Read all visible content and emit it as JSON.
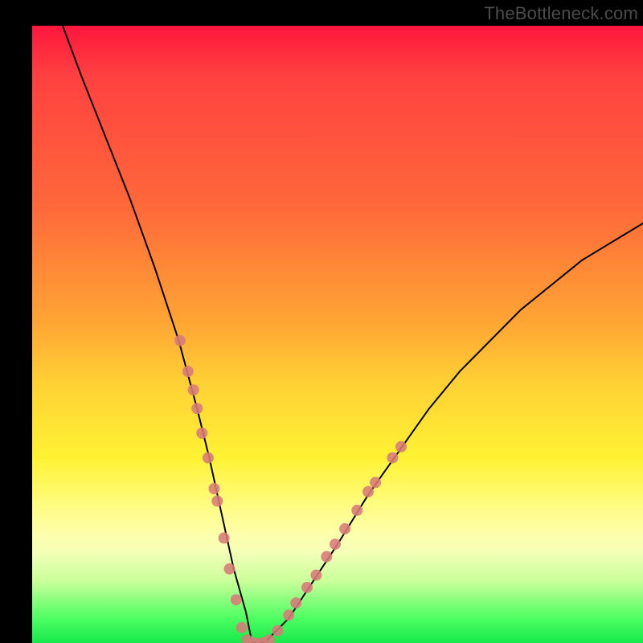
{
  "watermark": "TheBottleneck.com",
  "chart_data": {
    "type": "line",
    "title": "",
    "xlabel": "",
    "ylabel": "",
    "xlim": [
      0,
      100
    ],
    "ylim": [
      0,
      100
    ],
    "grid": false,
    "legend": false,
    "series": [
      {
        "name": "bottleneck-curve",
        "color": "#000000",
        "x": [
          5,
          8,
          12,
          16,
          20,
          24,
          27,
          29,
          31,
          33,
          35,
          36,
          38,
          42,
          46,
          50,
          55,
          60,
          65,
          70,
          75,
          80,
          85,
          90,
          95,
          100
        ],
        "y": [
          100,
          92,
          82,
          72,
          61,
          49,
          38,
          30,
          21,
          12,
          5,
          0,
          0,
          4,
          10,
          16,
          24,
          31,
          38,
          44,
          49,
          54,
          58,
          62,
          65,
          68
        ]
      }
    ],
    "markers": [
      {
        "name": "highlight-dots",
        "color": "#d87a7a",
        "radius": 7,
        "points": [
          {
            "x": 24.2,
            "y": 49
          },
          {
            "x": 25.5,
            "y": 44
          },
          {
            "x": 26.4,
            "y": 41
          },
          {
            "x": 27.0,
            "y": 38
          },
          {
            "x": 27.8,
            "y": 34
          },
          {
            "x": 28.8,
            "y": 30
          },
          {
            "x": 29.8,
            "y": 25
          },
          {
            "x": 30.3,
            "y": 23
          },
          {
            "x": 31.4,
            "y": 17
          },
          {
            "x": 32.3,
            "y": 12
          },
          {
            "x": 33.4,
            "y": 7
          },
          {
            "x": 34.3,
            "y": 2.5
          },
          {
            "x": 35.2,
            "y": 0.5
          },
          {
            "x": 36.3,
            "y": 0
          },
          {
            "x": 37.6,
            "y": 0
          },
          {
            "x": 38.8,
            "y": 0.5
          },
          {
            "x": 40.2,
            "y": 2
          },
          {
            "x": 42.0,
            "y": 4.5
          },
          {
            "x": 43.2,
            "y": 6.5
          },
          {
            "x": 45.0,
            "y": 9
          },
          {
            "x": 46.5,
            "y": 11
          },
          {
            "x": 48.2,
            "y": 14
          },
          {
            "x": 49.6,
            "y": 16
          },
          {
            "x": 51.2,
            "y": 18.5
          },
          {
            "x": 53.2,
            "y": 21.5
          },
          {
            "x": 55.0,
            "y": 24.5
          },
          {
            "x": 56.2,
            "y": 26
          },
          {
            "x": 59.0,
            "y": 30
          },
          {
            "x": 60.4,
            "y": 31.8
          }
        ]
      }
    ],
    "background_gradient": {
      "stops": [
        {
          "pos": 0,
          "color": "#ff163e"
        },
        {
          "pos": 30,
          "color": "#ff6a3a"
        },
        {
          "pos": 58,
          "color": "#ffd134"
        },
        {
          "pos": 78,
          "color": "#fffb7a"
        },
        {
          "pos": 92,
          "color": "#8dff7a"
        },
        {
          "pos": 100,
          "color": "#17e84a"
        }
      ]
    }
  }
}
